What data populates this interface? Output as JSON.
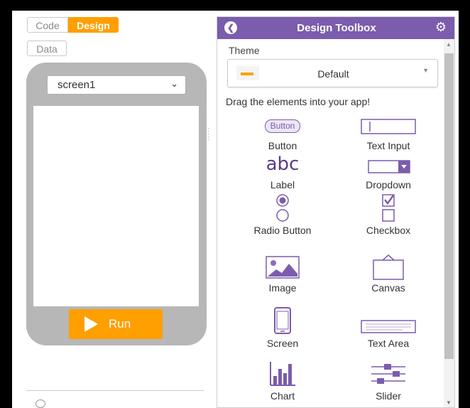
{
  "modes": {
    "code": "Code",
    "design": "Design",
    "data": "Data"
  },
  "screen_select": {
    "value": "screen1"
  },
  "run_label": "Run",
  "toolbox": {
    "title": "Design Toolbox",
    "theme_label": "Theme",
    "theme_value": "Default",
    "drag_hint": "Drag the elements into your app!",
    "tools": [
      {
        "label": "Button",
        "preview": "Button"
      },
      {
        "label": "Text Input"
      },
      {
        "label": "Label",
        "preview": "abc"
      },
      {
        "label": "Dropdown"
      },
      {
        "label": "Radio Button"
      },
      {
        "label": "Checkbox"
      },
      {
        "label": "Image"
      },
      {
        "label": "Canvas"
      },
      {
        "label": "Screen"
      },
      {
        "label": "Text Area"
      },
      {
        "label": "Chart"
      },
      {
        "label": "Slider"
      }
    ]
  },
  "colors": {
    "accent": "#ff9f00",
    "toolbox_header": "#7b5cad",
    "phone_frame": "#b7b7b7"
  },
  "icons": [
    "back-icon",
    "gear-icon",
    "chevron-down-icon",
    "play-icon"
  ]
}
